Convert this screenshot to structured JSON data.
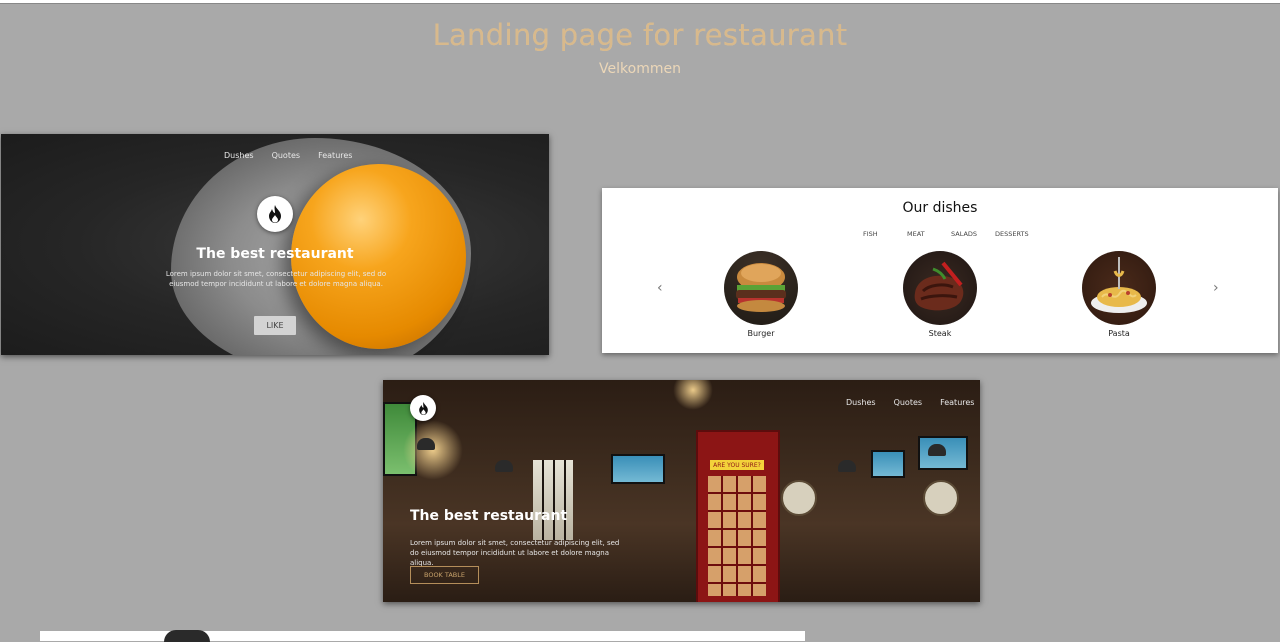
{
  "header": {
    "title": "Landing page for restaurant",
    "subtitle": "Velkommen"
  },
  "hero1": {
    "nav": [
      "Dushes",
      "Quotes",
      "Features"
    ],
    "logo_icon": "flame-icon",
    "title": "The best restaurant",
    "text": "Lorem ipsum dolor sit smet, consectetur adipiscing elit, sed do eiusmod tempor incididunt ut labore et dolore magna aliqua.",
    "button": "LIKE"
  },
  "dishes": {
    "title": "Our dishes",
    "tabs": [
      "FISH",
      "MEAT",
      "SALADS",
      "DESSERTS"
    ],
    "prev_icon": "chevron-left-icon",
    "next_icon": "chevron-right-icon",
    "items": [
      {
        "name": "Burger"
      },
      {
        "name": "Steak"
      },
      {
        "name": "Pasta"
      }
    ]
  },
  "hero3": {
    "nav": [
      "Dushes",
      "Quotes",
      "Features"
    ],
    "logo_icon": "flame-icon",
    "title": "The best restaurant",
    "text": "Lorem ipsum dolor sit smet, consectetur adipiscing elit, sed do eiusmod tempor incididunt ut labore et dolore magna aliqua.",
    "button": "BOOK TABLE",
    "booth_sign": "ARE YOU SURE?"
  },
  "colors": {
    "page_background": "#a9a9a9",
    "title_color": "#d8b98c"
  }
}
